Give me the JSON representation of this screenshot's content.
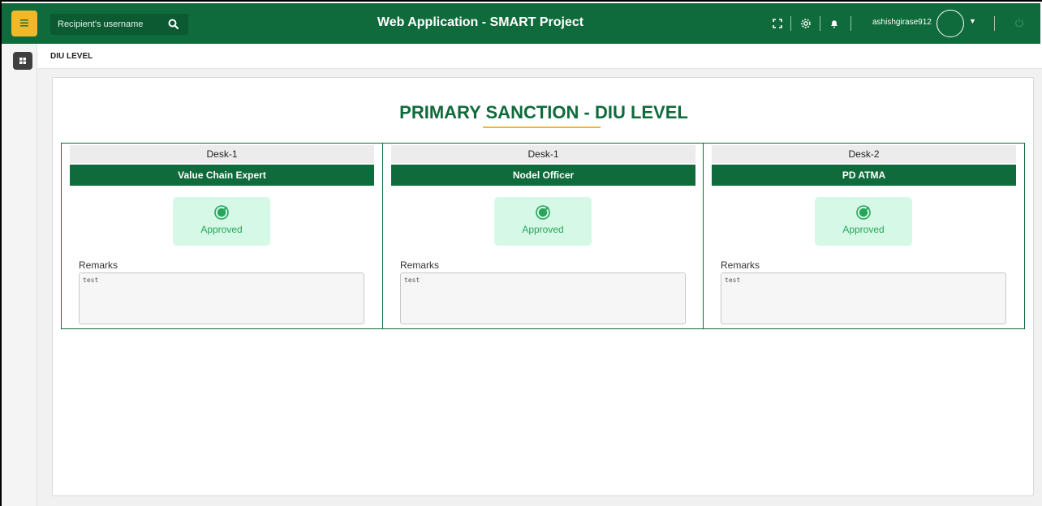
{
  "header": {
    "menu_icon": "hamburger-icon",
    "search_placeholder": "Recipient's username",
    "app_title": "Web Application - SMART Project",
    "username": "ashishgirase912",
    "icons": [
      "fullscreen-icon",
      "settings-icon",
      "bell-icon",
      "power-icon"
    ]
  },
  "breadcrumb": "DIU LEVEL",
  "page": {
    "title": "PRIMARY SANCTION - DIU LEVEL"
  },
  "desks": [
    {
      "desk": "Desk-1",
      "role": "Value Chain Expert",
      "status": "Approved",
      "remarks_label": "Remarks",
      "remarks": "test"
    },
    {
      "desk": "Desk-1",
      "role": "Nodel Officer",
      "status": "Approved",
      "remarks_label": "Remarks",
      "remarks": "test"
    },
    {
      "desk": "Desk-2",
      "role": "PD ATMA",
      "status": "Approved",
      "remarks_label": "Remarks",
      "remarks": "test"
    }
  ],
  "colors": {
    "brand_green": "#0f6b3b",
    "accent_yellow": "#f0b92b",
    "approved_bg": "#d6f8e6",
    "approved_text": "#26a55b"
  }
}
